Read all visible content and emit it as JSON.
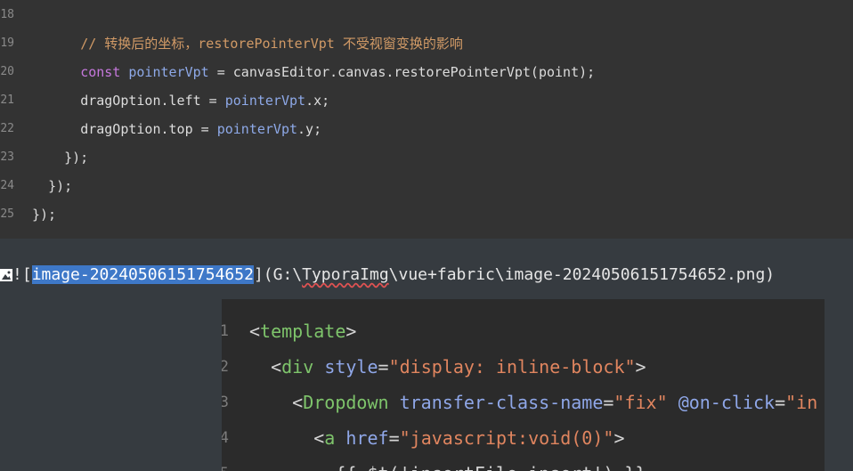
{
  "code_block": {
    "lines": [
      {
        "num": "18",
        "indent": "",
        "tokens": []
      },
      {
        "num": "19",
        "indent": "      ",
        "tokens": [
          {
            "cls": "c-comment",
            "text": "// 转换后的坐标，restorePointerVpt 不受视窗变换的影响"
          }
        ]
      },
      {
        "num": "20",
        "indent": "      ",
        "tokens": [
          {
            "cls": "c-kw",
            "text": "const "
          },
          {
            "cls": "c-var",
            "text": "pointerVpt"
          },
          {
            "cls": "c-plain",
            "text": " = canvasEditor.canvas.restorePointerVpt(point);"
          }
        ]
      },
      {
        "num": "21",
        "indent": "      ",
        "tokens": [
          {
            "cls": "c-plain",
            "text": "dragOption.left = "
          },
          {
            "cls": "c-var",
            "text": "pointerVpt"
          },
          {
            "cls": "c-plain",
            "text": ".x;"
          }
        ]
      },
      {
        "num": "22",
        "indent": "      ",
        "tokens": [
          {
            "cls": "c-plain",
            "text": "dragOption.top = "
          },
          {
            "cls": "c-var",
            "text": "pointerVpt"
          },
          {
            "cls": "c-plain",
            "text": ".y;"
          }
        ]
      },
      {
        "num": "23",
        "indent": "    ",
        "tokens": [
          {
            "cls": "c-plain",
            "text": "});"
          }
        ]
      },
      {
        "num": "24",
        "indent": "  ",
        "tokens": [
          {
            "cls": "c-plain",
            "text": "});"
          }
        ]
      },
      {
        "num": "25",
        "indent": "",
        "tokens": [
          {
            "cls": "c-plain",
            "text": "});"
          }
        ]
      }
    ]
  },
  "markdown_line": {
    "prefix": "![",
    "selected_text": "image-20240506151754652",
    "mid": "](G:\\",
    "misspelled": "TyporaImg",
    "suffix": "\\vue+fabric\\image-20240506151754652.png)"
  },
  "preview_image": {
    "lines": [
      {
        "num": "1",
        "tokens": [
          {
            "cls": "t-bracket",
            "text": "<"
          },
          {
            "cls": "t-tag",
            "text": "template"
          },
          {
            "cls": "t-bracket",
            "text": ">"
          }
        ]
      },
      {
        "num": "2",
        "tokens": [
          {
            "cls": "t-plain",
            "text": "  "
          },
          {
            "cls": "t-bracket",
            "text": "<"
          },
          {
            "cls": "t-tag",
            "text": "div"
          },
          {
            "cls": "t-plain",
            "text": " "
          },
          {
            "cls": "t-attr",
            "text": "style"
          },
          {
            "cls": "t-eq",
            "text": "="
          },
          {
            "cls": "t-str",
            "text": "\"display: inline-block\""
          },
          {
            "cls": "t-bracket",
            "text": ">"
          }
        ]
      },
      {
        "num": "3",
        "tokens": [
          {
            "cls": "t-plain",
            "text": "    "
          },
          {
            "cls": "t-bracket",
            "text": "<"
          },
          {
            "cls": "t-tag",
            "text": "Dropdown"
          },
          {
            "cls": "t-plain",
            "text": " "
          },
          {
            "cls": "t-attr",
            "text": "transfer-class-name"
          },
          {
            "cls": "t-eq",
            "text": "="
          },
          {
            "cls": "t-str",
            "text": "\"fix\""
          },
          {
            "cls": "t-plain",
            "text": " "
          },
          {
            "cls": "t-attr",
            "text": "@on-click"
          },
          {
            "cls": "t-eq",
            "text": "="
          },
          {
            "cls": "t-str",
            "text": "\"in"
          }
        ]
      },
      {
        "num": "4",
        "tokens": [
          {
            "cls": "t-plain",
            "text": "      "
          },
          {
            "cls": "t-bracket",
            "text": "<"
          },
          {
            "cls": "t-tag",
            "text": "a"
          },
          {
            "cls": "t-plain",
            "text": " "
          },
          {
            "cls": "t-attr",
            "text": "href"
          },
          {
            "cls": "t-eq",
            "text": "="
          },
          {
            "cls": "t-str",
            "text": "\"javascript:void(0)\""
          },
          {
            "cls": "t-bracket",
            "text": ">"
          }
        ]
      },
      {
        "num": "5",
        "tokens": [
          {
            "cls": "t-plain",
            "text": "        {{ $t('insertFile.insert') }}"
          }
        ]
      }
    ]
  }
}
